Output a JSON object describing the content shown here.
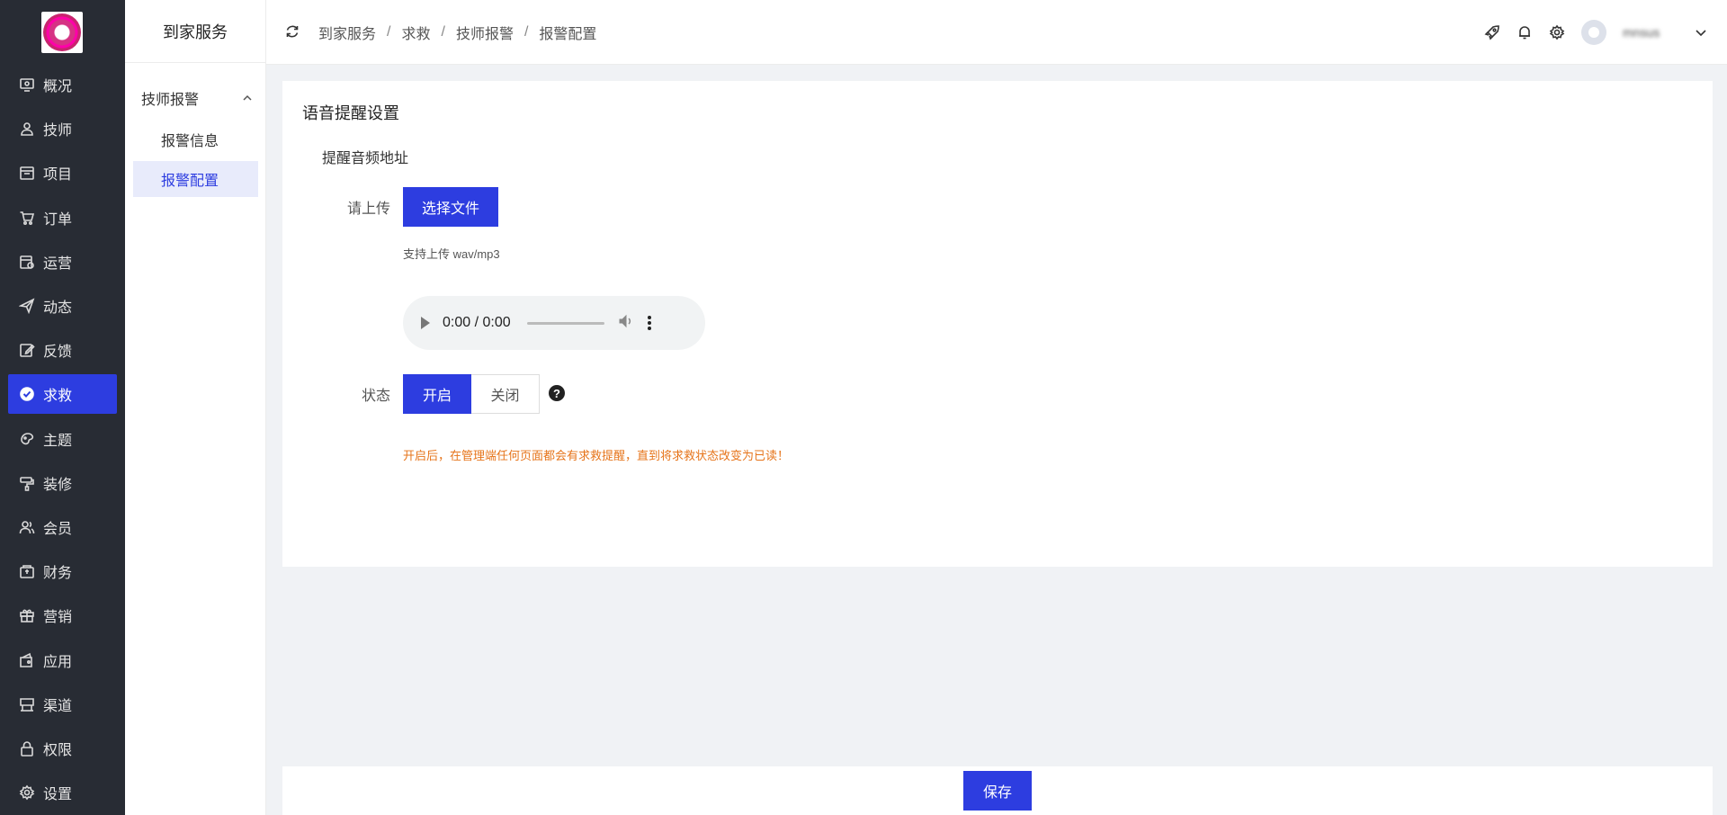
{
  "nav": {
    "items": [
      {
        "label": "概况",
        "icon": "monitor-icon"
      },
      {
        "label": "技师",
        "icon": "user-icon"
      },
      {
        "label": "项目",
        "icon": "calendar-icon"
      },
      {
        "label": "订单",
        "icon": "cart-icon"
      },
      {
        "label": "运营",
        "icon": "schedule-icon"
      },
      {
        "label": "动态",
        "icon": "send-icon"
      },
      {
        "label": "反馈",
        "icon": "edit-icon"
      },
      {
        "label": "求救",
        "icon": "check-circle-icon"
      },
      {
        "label": "主题",
        "icon": "palette-icon"
      },
      {
        "label": "装修",
        "icon": "paint-roller-icon"
      },
      {
        "label": "会员",
        "icon": "members-icon"
      },
      {
        "label": "财务",
        "icon": "wallet-icon"
      },
      {
        "label": "营销",
        "icon": "gift-icon"
      },
      {
        "label": "应用",
        "icon": "app-icon"
      },
      {
        "label": "渠道",
        "icon": "store-icon"
      },
      {
        "label": "权限",
        "icon": "lock-icon"
      },
      {
        "label": "设置",
        "icon": "gear-icon"
      }
    ],
    "active_index": 7,
    "accent": "#2d3de0",
    "background": "#282c34"
  },
  "subnav": {
    "title": "到家服务",
    "group_label": "技师报警",
    "items": [
      "报警信息",
      "报警配置"
    ]
  },
  "header": {
    "breadcrumb": [
      "到家服务",
      "求救",
      "技师报警",
      "报警配置"
    ],
    "username": "mnsus"
  },
  "main": {
    "title": "语音提醒设置",
    "section_label": "提醒音频地址",
    "upload_label": "请上传",
    "upload_button": "选择文件",
    "upload_hint": "支持上传 wav/mp3",
    "audio_time": "0:00 / 0:00",
    "status_label": "状态",
    "status_on": "开启",
    "status_off": "关闭",
    "help_symbol": "?",
    "warning": "开启后，在管理端任何页面都会有求救提醒，直到将求救状态改变为已读！",
    "warning_color": "#e6741a"
  },
  "footer": {
    "save_button": "保存"
  }
}
